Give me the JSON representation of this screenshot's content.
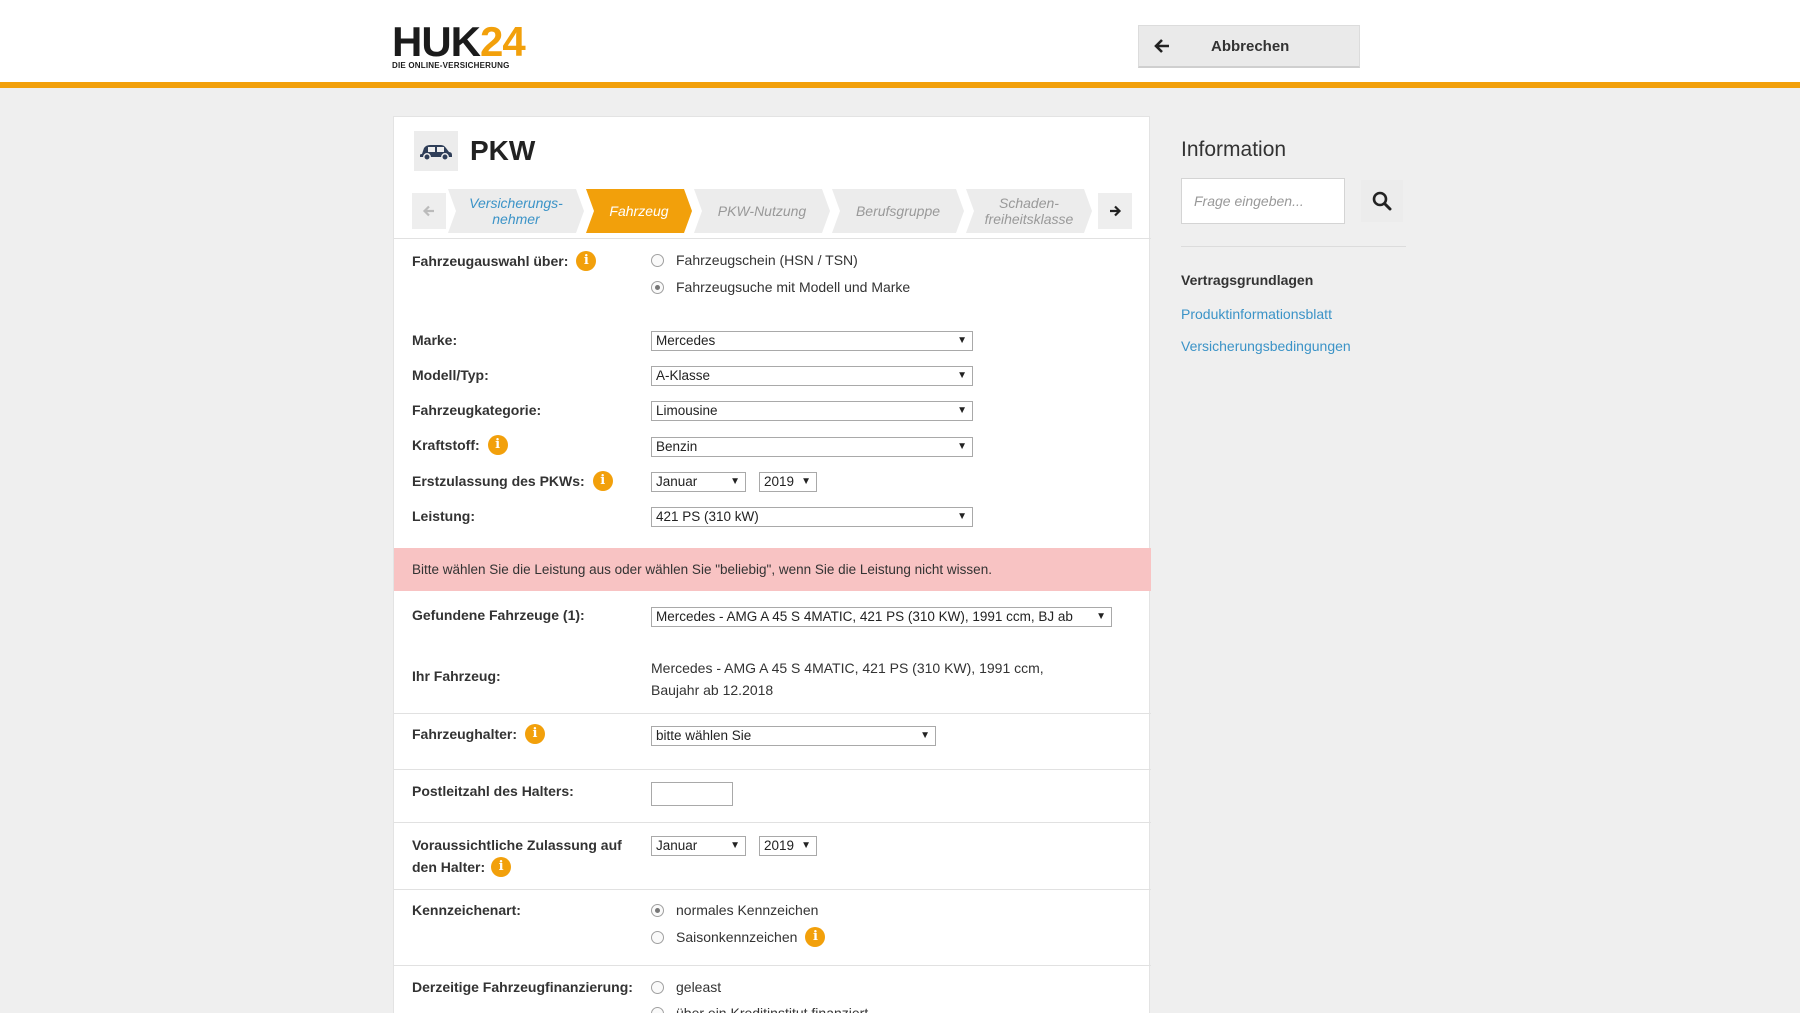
{
  "header": {
    "logo_main": "HUK",
    "logo_num": "24",
    "logo_sub": "DIE ONLINE-VERSICHERUNG",
    "cancel_label": "Abbrechen"
  },
  "card": {
    "title": "PKW",
    "steps": [
      {
        "label": "Versicherungs-\nnehmer",
        "state": "link"
      },
      {
        "label": "Fahrzeug",
        "state": "active"
      },
      {
        "label": "PKW-Nutzung",
        "state": "disabled"
      },
      {
        "label": "Berufsgruppe",
        "state": "disabled"
      },
      {
        "label": "Schaden-\nfreiheitsklasse",
        "state": "disabled"
      }
    ]
  },
  "form": {
    "selection_label": "Fahrzeugauswahl über:",
    "selection_options": [
      "Fahrzeugschein (HSN / TSN)",
      "Fahrzeugsuche mit Modell und Marke"
    ],
    "selection_selected": 1,
    "brand_label": "Marke:",
    "brand_value": "Mercedes",
    "model_label": "Modell/Typ:",
    "model_value": "A-Klasse",
    "category_label": "Fahrzeugkategorie:",
    "category_value": "Limousine",
    "fuel_label": "Kraftstoff:",
    "fuel_value": "Benzin",
    "registration_label": "Erstzulassung des PKWs:",
    "registration_month": "Januar",
    "registration_year": "2019",
    "power_label": "Leistung:",
    "power_value": "421 PS (310 kW)",
    "alert_text": "Bitte wählen Sie die Leistung aus oder wählen Sie \"beliebig\", wenn Sie die Leistung nicht wissen.",
    "found_label": "Gefundene Fahrzeuge (1):",
    "found_value": "Mercedes - AMG A 45 S 4MATIC, 421 PS (310 KW), 1991 ccm, BJ ab",
    "your_vehicle_label": "Ihr Fahrzeug:",
    "your_vehicle_line1": "Mercedes - AMG A 45 S 4MATIC, 421 PS (310 KW), 1991 ccm,",
    "your_vehicle_line2": "Baujahr ab 12.2018",
    "holder_label": "Fahrzeughalter:",
    "holder_value": "bitte wählen Sie",
    "postcode_label": "Postleitzahl des Halters:",
    "postcode_value": "",
    "expected_label_line1": "Voraussichtliche Zulassung auf",
    "expected_label_line2": "den Halter:",
    "expected_month": "Januar",
    "expected_year": "2019",
    "plate_label": "Kennzeichenart:",
    "plate_options": [
      "normales Kennzeichen",
      "Saisonkennzeichen"
    ],
    "plate_selected": 0,
    "financing_label": "Derzeitige Fahrzeugfinanzierung:",
    "financing_options": [
      "geleast",
      "über ein Kreditinstitut finanziert"
    ]
  },
  "sidebar": {
    "title": "Information",
    "search_placeholder": "Frage eingeben...",
    "subtitle": "Vertragsgrundlagen",
    "links": [
      "Produktinformationsblatt",
      "Versicherungsbedingungen"
    ]
  },
  "colors": {
    "accent": "#f2a00b",
    "link": "#3b93c7",
    "alert_bg": "#f8c3c3"
  }
}
